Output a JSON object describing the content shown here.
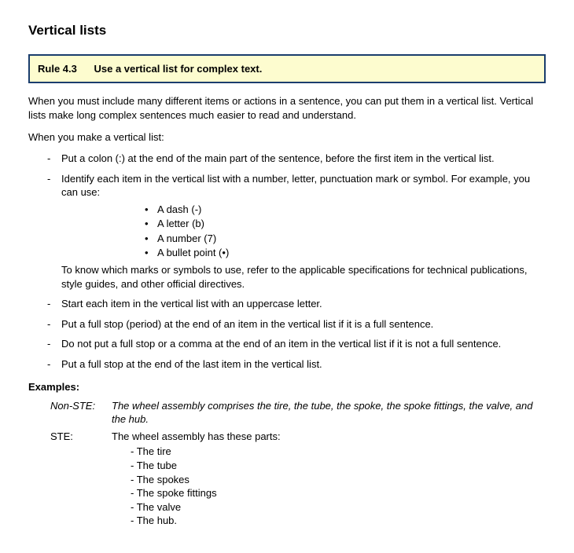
{
  "title": "Vertical lists",
  "rule": {
    "label": "Rule 4.3",
    "text": "Use a vertical list for complex text."
  },
  "intro": "When you must include many different items or actions in a sentence, you can put them in a vertical list. Vertical lists make long complex sentences much easier to read and understand.",
  "lead_in": "When you make a vertical list:",
  "items": {
    "i0": "Put a colon (:) at the end of the main part of the sentence, before the first item in the vertical list.",
    "i1_pre": "Identify each item in the vertical list with a number, letter, punctuation mark or symbol. For example, you can use:",
    "i1_sub": {
      "s0": "A dash (-)",
      "s1": "A letter (b)",
      "s2": "A number (7)",
      "s3": "A bullet point (•)"
    },
    "i1_post": "To know which marks or symbols to use, refer to the applicable specifications for technical publications, style guides, and other official directives.",
    "i2": "Start each item in the vertical list with an uppercase letter.",
    "i3": "Put a full stop (period) at the end of an item in the vertical list if it is a full sentence.",
    "i4": "Do not put a full stop or a comma at the end of an item in the vertical list if it is not a full sentence.",
    "i5": "Put a full stop at the end of the last item in the vertical list."
  },
  "examples_heading": "Examples:",
  "examples": {
    "nonste_label": "Non-STE:",
    "nonste_text": "The wheel assembly comprises the tire, the tube, the spoke, the spoke fittings, the valve, and the hub.",
    "ste_label": "STE:",
    "ste_intro": "The wheel assembly has these parts:",
    "ste_items": {
      "p0": "- The tire",
      "p1": "- The tube",
      "p2": "- The spokes",
      "p3": "- The spoke fittings",
      "p4": "- The valve",
      "p5": "- The hub."
    }
  }
}
